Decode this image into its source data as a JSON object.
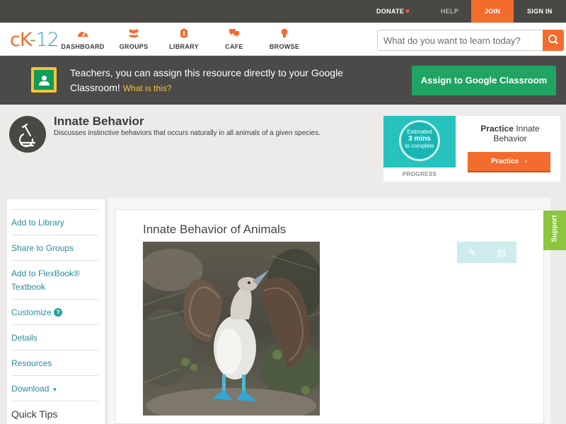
{
  "topbar": {
    "donate": "DONATE",
    "help": "HELP",
    "join": "JOIN",
    "signin": "SIGN IN"
  },
  "nav": {
    "logo": {
      "c": "c",
      "k": "K",
      "dash": "-",
      "num": "12"
    },
    "items": [
      {
        "label": "DASHBOARD",
        "icon": "dashboard-icon"
      },
      {
        "label": "GROUPS",
        "icon": "groups-icon"
      },
      {
        "label": "LIBRARY",
        "icon": "library-icon"
      },
      {
        "label": "CAFE",
        "icon": "cafe-icon"
      },
      {
        "label": "BROWSE",
        "icon": "browse-icon"
      }
    ],
    "search_placeholder": "What do you want to learn today?"
  },
  "banner": {
    "text": "Teachers, you can assign this resource directly to your Google Classroom!",
    "what": "What is this?",
    "button": "Assign to Google Classroom"
  },
  "concept": {
    "title": "Innate Behavior",
    "description": "Discusses instinctive behaviors that occurs naturally in all animals of a given species."
  },
  "practice": {
    "estimated": "Estimated",
    "mins": "3 mins",
    "to_complete": "to complete",
    "progress_label": "PROGRESS",
    "title_bold": "Practice",
    "title_rest": "Innate Behavior",
    "button": "Practice"
  },
  "sidebar": {
    "items": [
      {
        "label": "Add to Library"
      },
      {
        "label": "Share to Groups"
      },
      {
        "label": "Add to FlexBook® Textbook"
      },
      {
        "label": "Customize"
      },
      {
        "label": "Details"
      },
      {
        "label": "Resources"
      },
      {
        "label": "Download"
      },
      {
        "label": "Quick Tips"
      }
    ],
    "customize_badge": "?"
  },
  "article": {
    "title": "Innate Behavior of Animals"
  },
  "support": "Support",
  "colors": {
    "brand_orange": "#f26c2e",
    "classroom_green": "#1fa463",
    "link_teal": "#2a8c9c",
    "support_green": "#8cc63e"
  }
}
